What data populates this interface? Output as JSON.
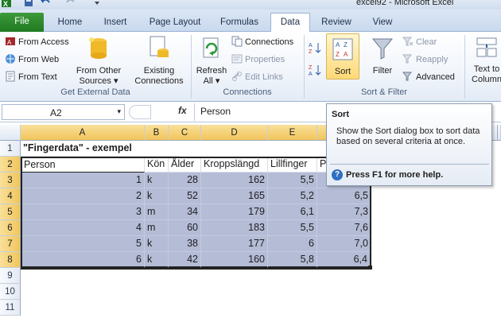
{
  "window": {
    "title": "excel92 - Microsoft Excel"
  },
  "tabs": [
    {
      "label": "File"
    },
    {
      "label": "Home"
    },
    {
      "label": "Insert"
    },
    {
      "label": "Page Layout"
    },
    {
      "label": "Formulas"
    },
    {
      "label": "Data"
    },
    {
      "label": "Review"
    },
    {
      "label": "View"
    }
  ],
  "ribbon": {
    "get_external_data": {
      "label": "Get External Data",
      "from_access": "From Access",
      "from_web": "From Web",
      "from_text": "From Text",
      "from_other_1": "From Other",
      "from_other_2": "Sources",
      "existing_1": "Existing",
      "existing_2": "Connections"
    },
    "connections": {
      "label": "Connections",
      "refresh_1": "Refresh",
      "refresh_2": "All",
      "connections": "Connections",
      "properties": "Properties",
      "edit_links": "Edit Links"
    },
    "sort_filter": {
      "label": "Sort & Filter",
      "sort": "Sort",
      "filter": "Filter",
      "clear": "Clear",
      "reapply": "Reapply",
      "advanced": "Advanced",
      "text_to_1": "Text to",
      "text_to_2": "Column"
    }
  },
  "formula_bar": {
    "name_box": "A2",
    "fx": "fx",
    "value": "Person"
  },
  "grid": {
    "columns": [
      "A",
      "B",
      "C",
      "D",
      "E"
    ],
    "rows": [
      "1",
      "2",
      "3",
      "4",
      "5",
      "6",
      "7",
      "8",
      "9",
      "10",
      "11"
    ],
    "title": "\"Fingerdata\" - exempel",
    "headers": [
      "Person",
      "Kön",
      "Ålder",
      "Kroppslängd",
      "Lillfinger",
      "P"
    ],
    "data": [
      {
        "a": "1",
        "b": "k",
        "c": "28",
        "d": "162",
        "e": "5,5",
        "f": ""
      },
      {
        "a": "2",
        "b": "k",
        "c": "52",
        "d": "165",
        "e": "5,2",
        "f": "6,5"
      },
      {
        "a": "3",
        "b": "m",
        "c": "34",
        "d": "179",
        "e": "6,1",
        "f": "7,3"
      },
      {
        "a": "4",
        "b": "m",
        "c": "60",
        "d": "183",
        "e": "5,5",
        "f": "7,6"
      },
      {
        "a": "5",
        "b": "k",
        "c": "38",
        "d": "177",
        "e": "6",
        "f": "7,0"
      },
      {
        "a": "6",
        "b": "k",
        "c": "42",
        "d": "160",
        "e": "5,8",
        "f": "6,4"
      }
    ]
  },
  "tooltip": {
    "title": "Sort",
    "description": "Show the Sort dialog box to sort data based on several criteria at once.",
    "help": "Press F1 for more help."
  }
}
